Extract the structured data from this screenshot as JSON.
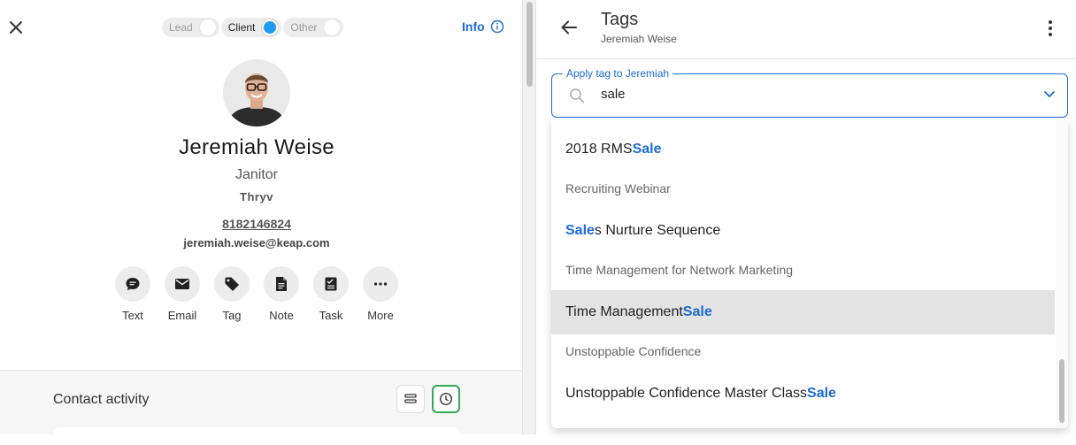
{
  "contact_panel": {
    "close_icon": "close-icon",
    "status_toggles": [
      {
        "label": "Lead",
        "active": false
      },
      {
        "label": "Client",
        "active": true
      },
      {
        "label": "Other",
        "active": false
      }
    ],
    "info_label": "Info",
    "name": "Jeremiah Weise",
    "job_title": "Janitor",
    "company": "Thryv",
    "phone": "8182146824",
    "email": "jeremiah.weise@keap.com",
    "actions": [
      {
        "label": "Text",
        "icon": "chat-icon"
      },
      {
        "label": "Email",
        "icon": "envelope-icon"
      },
      {
        "label": "Tag",
        "icon": "tag-icon"
      },
      {
        "label": "Note",
        "icon": "note-icon"
      },
      {
        "label": "Task",
        "icon": "task-icon"
      },
      {
        "label": "More",
        "icon": "more-icon"
      }
    ],
    "activity_title": "Contact activity"
  },
  "tags_panel": {
    "title": "Tags",
    "subtitle": "Jeremiah Weise",
    "field_label": "Apply tag to Jeremiah",
    "search_value": "sale",
    "options": [
      {
        "pre": "2018 RMS ",
        "match": "Sale",
        "post": "",
        "type": "tag",
        "highlighted": false
      },
      {
        "pre": "Recruiting Webinar",
        "match": "",
        "post": "",
        "type": "category",
        "highlighted": false
      },
      {
        "pre": "",
        "match": "Sale",
        "post": "s Nurture Sequence",
        "type": "tag",
        "highlighted": false
      },
      {
        "pre": "Time Management for Network Marketing",
        "match": "",
        "post": "",
        "type": "category",
        "highlighted": false
      },
      {
        "pre": "Time Management ",
        "match": "Sale",
        "post": "",
        "type": "tag",
        "highlighted": true
      },
      {
        "pre": "Unstoppable Confidence",
        "match": "",
        "post": "",
        "type": "category",
        "highlighted": false
      },
      {
        "pre": "Unstoppable Confidence Master Class ",
        "match": "Sale",
        "post": "",
        "type": "tag",
        "highlighted": false
      }
    ]
  },
  "colors": {
    "accent": "#1a6bd6",
    "toggle_active": "#1e9bf0",
    "timeline_active": "#34a853"
  }
}
